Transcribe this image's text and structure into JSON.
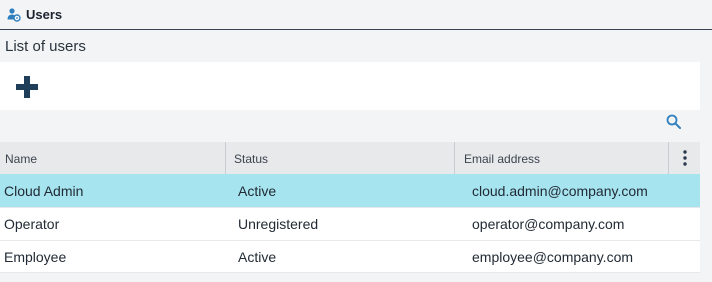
{
  "header": {
    "title": "Users",
    "icon": "users-settings-icon"
  },
  "section": {
    "title": "List of users"
  },
  "toolbar": {
    "add_icon": "plus-icon",
    "search_icon": "search-icon"
  },
  "table": {
    "columns": [
      "Name",
      "Status",
      "Email address"
    ],
    "menu_icon": "vertical-ellipsis-icon",
    "rows": [
      {
        "name": "Cloud Admin",
        "status": "Active",
        "email": "cloud.admin@company.com",
        "selected": true
      },
      {
        "name": "Operator",
        "status": "Unregistered",
        "email": "operator@company.com",
        "selected": false
      },
      {
        "name": "Employee",
        "status": "Active",
        "email": "employee@company.com",
        "selected": false
      }
    ]
  },
  "colors": {
    "selected_row": "#a6e4ef",
    "accent_icon": "#2f7fbf",
    "add_icon": "#1f3e5a"
  }
}
